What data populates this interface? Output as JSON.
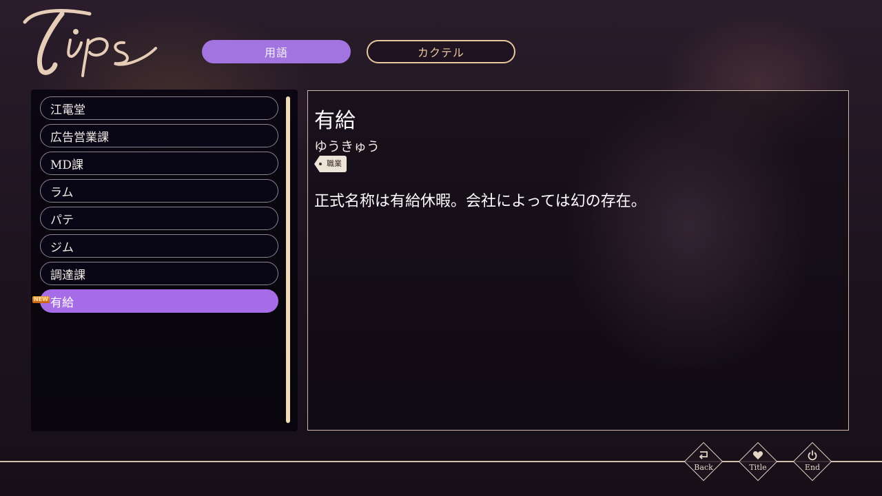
{
  "logo": {
    "text": "Tips"
  },
  "tabs": [
    {
      "label": "用語",
      "active": true
    },
    {
      "label": "カクテル",
      "active": false
    }
  ],
  "list": {
    "items": [
      {
        "label": "江電堂"
      },
      {
        "label": "広告営業課"
      },
      {
        "label": "MD課"
      },
      {
        "label": "ラム"
      },
      {
        "label": "パテ"
      },
      {
        "label": "ジム"
      },
      {
        "label": "調達課"
      },
      {
        "label": "有給",
        "selected": true,
        "new": true
      }
    ],
    "new_badge": "NEW"
  },
  "detail": {
    "title": "有給",
    "reading": "ゆうきゅう",
    "tag": "職業",
    "description": "正式名称は有給休暇。会社によっては幻の存在。"
  },
  "nav": {
    "back": "Back",
    "title": "Title",
    "end": "End"
  },
  "colors": {
    "accent": "#a66ce8",
    "gold": "#e8c9a0",
    "border": "#cfb8b0"
  }
}
